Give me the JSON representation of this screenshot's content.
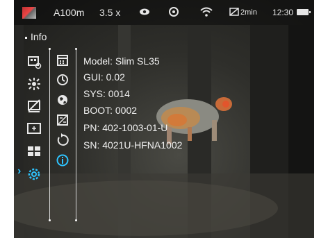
{
  "status": {
    "model": "A100m",
    "zoom": "3.5 x",
    "recording_time": "2min",
    "clock": "12:30"
  },
  "menu": {
    "title": "Info"
  },
  "info": {
    "model_line": "Model:  Slim SL35",
    "gui_line": "GUI:  0.02",
    "sys_line": "SYS:  0014",
    "boot_line": "BOOT:  0002",
    "pn_line": "PN:  402-1003-01-U",
    "sn_line": "SN:  4021U-HFNA1002"
  },
  "colors": {
    "accent": "#2ec4ff",
    "text": "#f2f2f2"
  }
}
